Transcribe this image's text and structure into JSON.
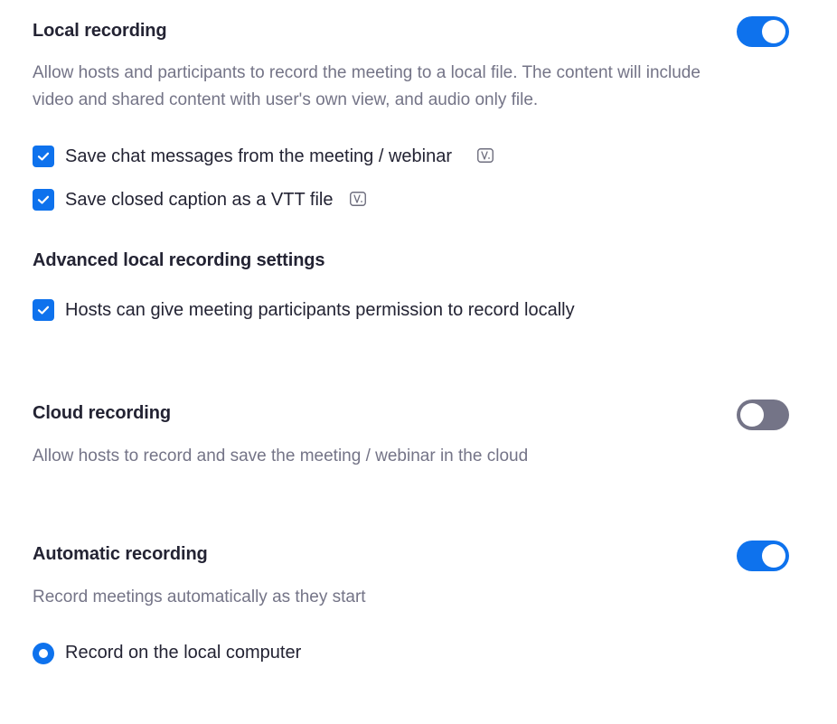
{
  "local_recording": {
    "title": "Local recording",
    "toggle_state": "on",
    "description": "Allow hosts and participants to record the meeting to a local file. The content will include video and shared content with user's own view, and audio only file.",
    "options": [
      {
        "label": "Save chat messages from the meeting / webinar",
        "checked": true,
        "icon": "version-icon"
      },
      {
        "label": "Save closed caption as a VTT file",
        "checked": true,
        "icon": "version-icon"
      }
    ],
    "advanced": {
      "title": "Advanced local recording settings",
      "options": [
        {
          "label": "Hosts can give meeting participants permission to record locally",
          "checked": true
        }
      ]
    }
  },
  "cloud_recording": {
    "title": "Cloud recording",
    "toggle_state": "off",
    "description": "Allow hosts to record and save the meeting / webinar in the cloud"
  },
  "automatic_recording": {
    "title": "Automatic recording",
    "toggle_state": "on",
    "description": "Record meetings automatically as they start",
    "radio_options": [
      {
        "label": "Record on the local computer",
        "selected": true
      }
    ]
  },
  "colors": {
    "accent": "#0e72ed",
    "toggle_off": "#747487",
    "title_text": "#232333",
    "description_text": "#747487"
  }
}
